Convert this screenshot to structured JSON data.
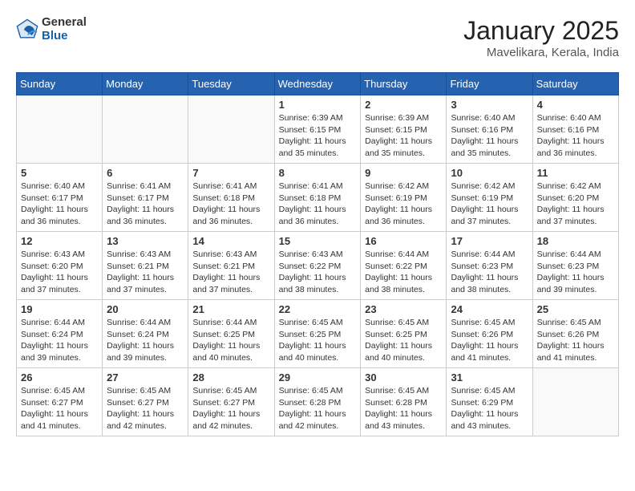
{
  "header": {
    "logo_general": "General",
    "logo_blue": "Blue",
    "month_year": "January 2025",
    "location": "Mavelikara, Kerala, India"
  },
  "days_of_week": [
    "Sunday",
    "Monday",
    "Tuesday",
    "Wednesday",
    "Thursday",
    "Friday",
    "Saturday"
  ],
  "weeks": [
    [
      {
        "day": "",
        "info": ""
      },
      {
        "day": "",
        "info": ""
      },
      {
        "day": "",
        "info": ""
      },
      {
        "day": "1",
        "info": "Sunrise: 6:39 AM\nSunset: 6:15 PM\nDaylight: 11 hours\nand 35 minutes."
      },
      {
        "day": "2",
        "info": "Sunrise: 6:39 AM\nSunset: 6:15 PM\nDaylight: 11 hours\nand 35 minutes."
      },
      {
        "day": "3",
        "info": "Sunrise: 6:40 AM\nSunset: 6:16 PM\nDaylight: 11 hours\nand 35 minutes."
      },
      {
        "day": "4",
        "info": "Sunrise: 6:40 AM\nSunset: 6:16 PM\nDaylight: 11 hours\nand 36 minutes."
      }
    ],
    [
      {
        "day": "5",
        "info": "Sunrise: 6:40 AM\nSunset: 6:17 PM\nDaylight: 11 hours\nand 36 minutes."
      },
      {
        "day": "6",
        "info": "Sunrise: 6:41 AM\nSunset: 6:17 PM\nDaylight: 11 hours\nand 36 minutes."
      },
      {
        "day": "7",
        "info": "Sunrise: 6:41 AM\nSunset: 6:18 PM\nDaylight: 11 hours\nand 36 minutes."
      },
      {
        "day": "8",
        "info": "Sunrise: 6:41 AM\nSunset: 6:18 PM\nDaylight: 11 hours\nand 36 minutes."
      },
      {
        "day": "9",
        "info": "Sunrise: 6:42 AM\nSunset: 6:19 PM\nDaylight: 11 hours\nand 36 minutes."
      },
      {
        "day": "10",
        "info": "Sunrise: 6:42 AM\nSunset: 6:19 PM\nDaylight: 11 hours\nand 37 minutes."
      },
      {
        "day": "11",
        "info": "Sunrise: 6:42 AM\nSunset: 6:20 PM\nDaylight: 11 hours\nand 37 minutes."
      }
    ],
    [
      {
        "day": "12",
        "info": "Sunrise: 6:43 AM\nSunset: 6:20 PM\nDaylight: 11 hours\nand 37 minutes."
      },
      {
        "day": "13",
        "info": "Sunrise: 6:43 AM\nSunset: 6:21 PM\nDaylight: 11 hours\nand 37 minutes."
      },
      {
        "day": "14",
        "info": "Sunrise: 6:43 AM\nSunset: 6:21 PM\nDaylight: 11 hours\nand 37 minutes."
      },
      {
        "day": "15",
        "info": "Sunrise: 6:43 AM\nSunset: 6:22 PM\nDaylight: 11 hours\nand 38 minutes."
      },
      {
        "day": "16",
        "info": "Sunrise: 6:44 AM\nSunset: 6:22 PM\nDaylight: 11 hours\nand 38 minutes."
      },
      {
        "day": "17",
        "info": "Sunrise: 6:44 AM\nSunset: 6:23 PM\nDaylight: 11 hours\nand 38 minutes."
      },
      {
        "day": "18",
        "info": "Sunrise: 6:44 AM\nSunset: 6:23 PM\nDaylight: 11 hours\nand 39 minutes."
      }
    ],
    [
      {
        "day": "19",
        "info": "Sunrise: 6:44 AM\nSunset: 6:24 PM\nDaylight: 11 hours\nand 39 minutes."
      },
      {
        "day": "20",
        "info": "Sunrise: 6:44 AM\nSunset: 6:24 PM\nDaylight: 11 hours\nand 39 minutes."
      },
      {
        "day": "21",
        "info": "Sunrise: 6:44 AM\nSunset: 6:25 PM\nDaylight: 11 hours\nand 40 minutes."
      },
      {
        "day": "22",
        "info": "Sunrise: 6:45 AM\nSunset: 6:25 PM\nDaylight: 11 hours\nand 40 minutes."
      },
      {
        "day": "23",
        "info": "Sunrise: 6:45 AM\nSunset: 6:25 PM\nDaylight: 11 hours\nand 40 minutes."
      },
      {
        "day": "24",
        "info": "Sunrise: 6:45 AM\nSunset: 6:26 PM\nDaylight: 11 hours\nand 41 minutes."
      },
      {
        "day": "25",
        "info": "Sunrise: 6:45 AM\nSunset: 6:26 PM\nDaylight: 11 hours\nand 41 minutes."
      }
    ],
    [
      {
        "day": "26",
        "info": "Sunrise: 6:45 AM\nSunset: 6:27 PM\nDaylight: 11 hours\nand 41 minutes."
      },
      {
        "day": "27",
        "info": "Sunrise: 6:45 AM\nSunset: 6:27 PM\nDaylight: 11 hours\nand 42 minutes."
      },
      {
        "day": "28",
        "info": "Sunrise: 6:45 AM\nSunset: 6:27 PM\nDaylight: 11 hours\nand 42 minutes."
      },
      {
        "day": "29",
        "info": "Sunrise: 6:45 AM\nSunset: 6:28 PM\nDaylight: 11 hours\nand 42 minutes."
      },
      {
        "day": "30",
        "info": "Sunrise: 6:45 AM\nSunset: 6:28 PM\nDaylight: 11 hours\nand 43 minutes."
      },
      {
        "day": "31",
        "info": "Sunrise: 6:45 AM\nSunset: 6:29 PM\nDaylight: 11 hours\nand 43 minutes."
      },
      {
        "day": "",
        "info": ""
      }
    ]
  ]
}
